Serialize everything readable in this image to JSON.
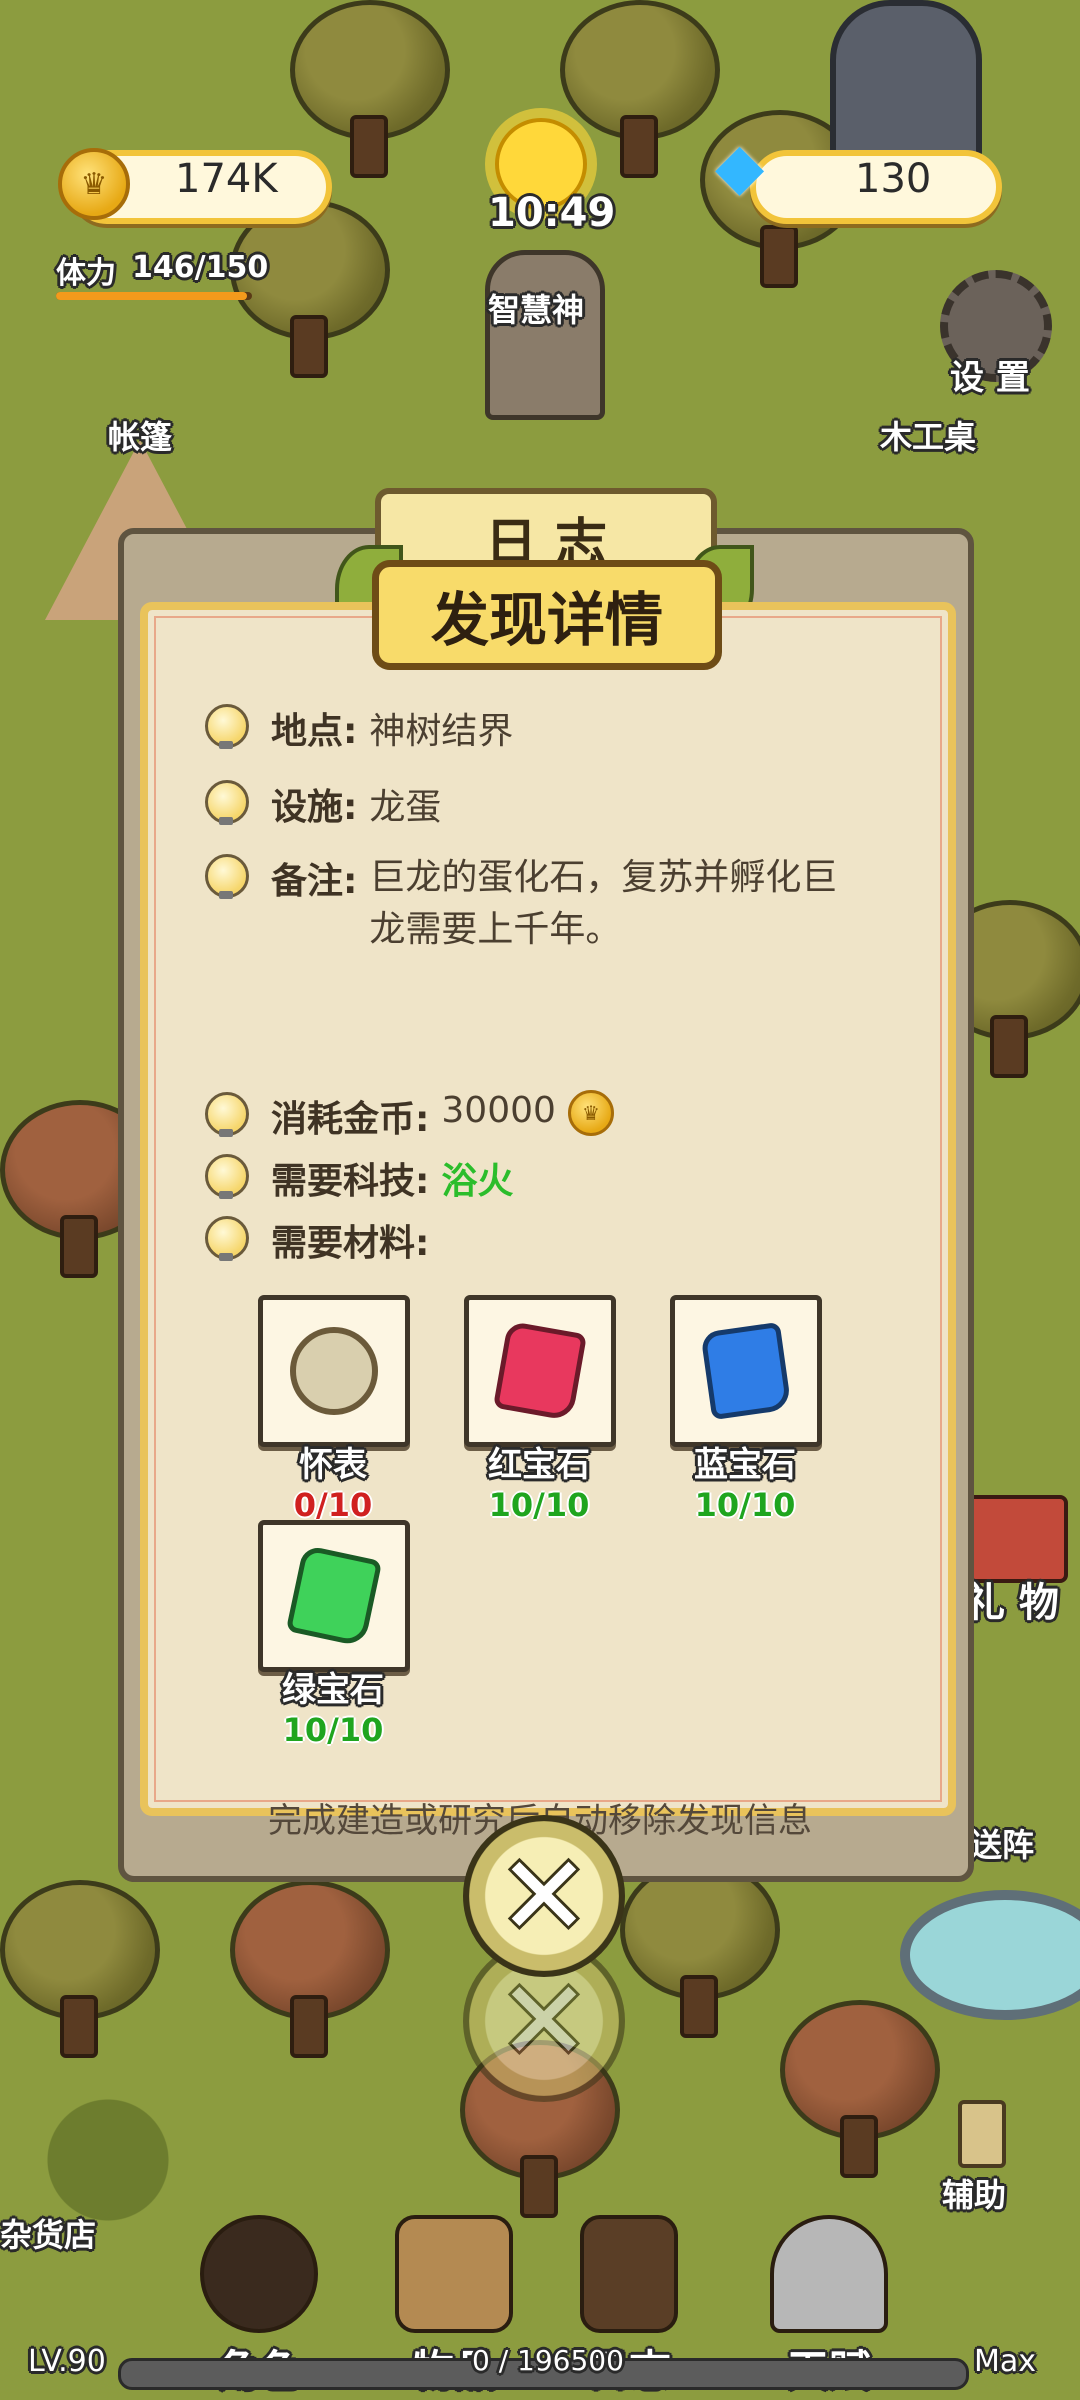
{
  "hud": {
    "coins": "174K",
    "gems": "130",
    "time": "10:49",
    "stamina_label": "体力",
    "stamina_value": "146/150",
    "stamina_fraction": 0.973
  },
  "map_labels": {
    "statue": "智慧神",
    "settings": "设 置",
    "tent": "帐篷",
    "workbench": "木工桌",
    "gift": "礼 物",
    "portal": "送阵",
    "assist": "辅助",
    "shop": "杂货店"
  },
  "modal": {
    "back_title": "日 志",
    "title": "发现详情",
    "location_key": "地点:",
    "location_val": "神树结界",
    "facility_key": "设施:",
    "facility_val": "龙蛋",
    "note_key": "备注:",
    "note_val": "巨龙的蛋化石，复苏并孵化巨龙需要上千年。",
    "cost_key": "消耗金币:",
    "cost_val": "30000",
    "tech_key": "需要科技:",
    "tech_val": "浴火",
    "materials_key": "需要材料:",
    "materials": [
      {
        "name": "怀表",
        "count": "0/10",
        "status": "missing",
        "icon": "pocket-watch-icon"
      },
      {
        "name": "红宝石",
        "count": "10/10",
        "status": "ok",
        "icon": "ruby-icon"
      },
      {
        "name": "蓝宝石",
        "count": "10/10",
        "status": "ok",
        "icon": "sapphire-icon"
      },
      {
        "name": "绿宝石",
        "count": "10/10",
        "status": "ok",
        "icon": "emerald-icon"
      }
    ],
    "footer_note": "完成建造或研究后自动移除发现信息"
  },
  "bottom_nav": {
    "character": "角色",
    "items": "物品",
    "journal": "日志",
    "talent": "天赋"
  },
  "xp": {
    "level": "LV.90",
    "progress": "0 / 196500",
    "max_label": "Max"
  },
  "colors": {
    "gold_border": "#f2c43a",
    "missing": "#d02020",
    "ok": "#1fa51f",
    "tech": "#2bbd2b"
  }
}
